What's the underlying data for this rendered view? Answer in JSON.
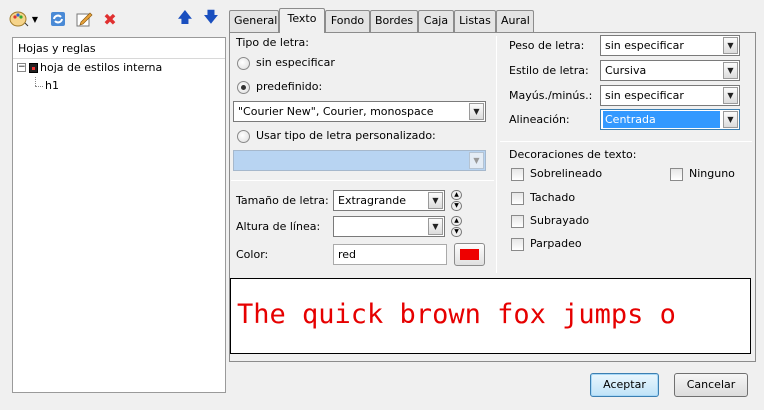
{
  "toolbar": {
    "icons": [
      "palette-menu-icon",
      "refresh-icon",
      "edit-icon",
      "delete-icon",
      "move-up-icon",
      "move-down-icon"
    ]
  },
  "tree": {
    "header": "Hojas y reglas",
    "root": "hoja de estilos interna",
    "child": "h1"
  },
  "tabs": [
    "General",
    "Texto",
    "Fondo",
    "Bordes",
    "Caja",
    "Listas",
    "Aural"
  ],
  "font": {
    "section_label": "Tipo de letra:",
    "unspecified_label": "sin especificar",
    "predefined_label": "predefinido:",
    "predefined_value": "\"Courier New\", Courier, monospace",
    "custom_label": "Usar tipo de letra personalizado:",
    "custom_value": ""
  },
  "size": {
    "size_label": "Tamaño de letra:",
    "size_value": "Extragrande",
    "line_height_label": "Altura de línea:",
    "line_height_value": "",
    "color_label": "Color:",
    "color_value": "red"
  },
  "style": {
    "weight_label": "Peso de letra:",
    "weight_value": "sin especificar",
    "style_label": "Estilo de letra:",
    "style_value": "Cursiva",
    "case_label": "Mayús./minús.:",
    "case_value": "sin especificar",
    "align_label": "Alineación:",
    "align_value": "Centrada"
  },
  "decorations": {
    "title": "Decoraciones de texto:",
    "overline": "Sobrelineado",
    "none": "Ninguno",
    "strike": "Tachado",
    "underline": "Subrayado",
    "blink": "Parpadeo"
  },
  "preview": {
    "text": "The quick brown fox jumps o"
  },
  "buttons": {
    "ok": "Aceptar",
    "cancel": "Cancelar"
  },
  "colors": {
    "preview_text": "#e60000",
    "swatch": "#ee0000",
    "selection": "#3399ff"
  }
}
